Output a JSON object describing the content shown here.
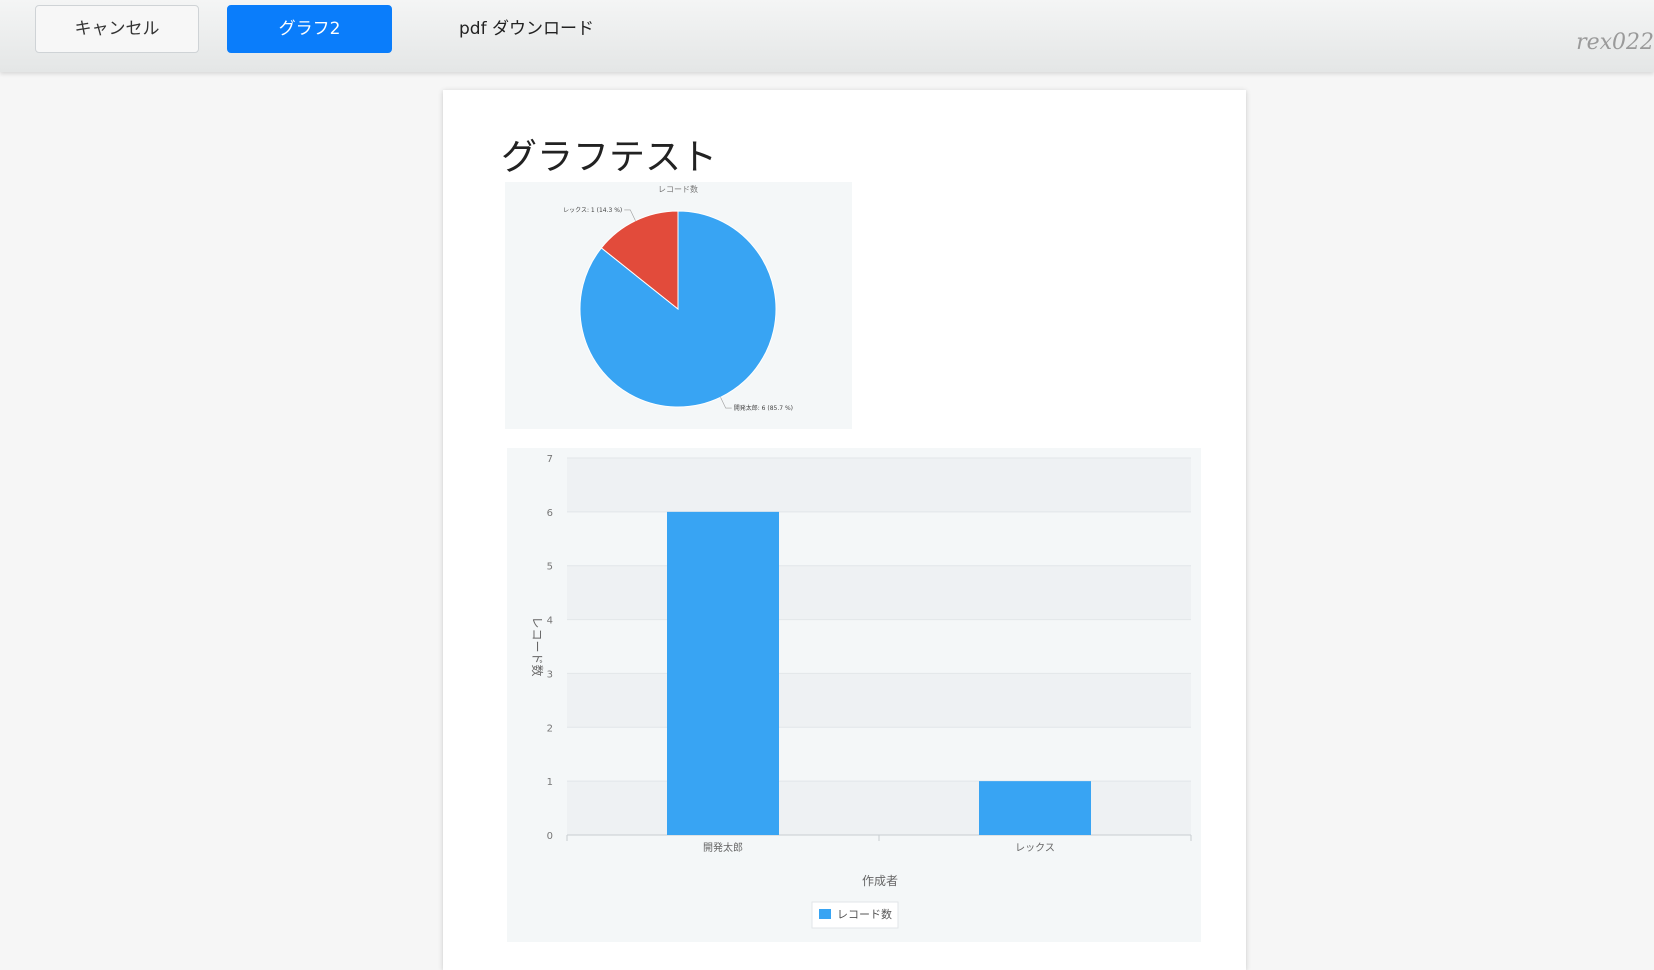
{
  "toolbar": {
    "cancel_label": "キャンセル",
    "graph_label": "グラフ2",
    "pdf_label": "pdf ダウンロード",
    "user_label": "rex022"
  },
  "report": {
    "title": "グラフテスト"
  },
  "colors": {
    "primary_button": "#0a7dfb",
    "series_blue": "#38a4f3",
    "series_red": "#e24b3b"
  },
  "chart_data": [
    {
      "type": "pie",
      "title": "レコード数",
      "slices": [
        {
          "label": "開発太郎",
          "value": 6,
          "percent": 85.7,
          "display": "開発太郎: 6 (85.7 %)",
          "color": "#38a4f3"
        },
        {
          "label": "レックス",
          "value": 1,
          "percent": 14.3,
          "display": "レックス: 1 (14.3 %)",
          "color": "#e24b3b"
        }
      ]
    },
    {
      "type": "bar",
      "categories": [
        "開発太郎",
        "レックス"
      ],
      "series": [
        {
          "name": "レコード数",
          "values": [
            6,
            1
          ],
          "color": "#38a4f3"
        }
      ],
      "xlabel": "作成者",
      "ylabel": "レコード数",
      "ylim": [
        0,
        7
      ],
      "yticks": [
        0,
        1,
        2,
        3,
        4,
        5,
        6,
        7
      ],
      "grid": true,
      "legend": "bottom-center"
    }
  ]
}
